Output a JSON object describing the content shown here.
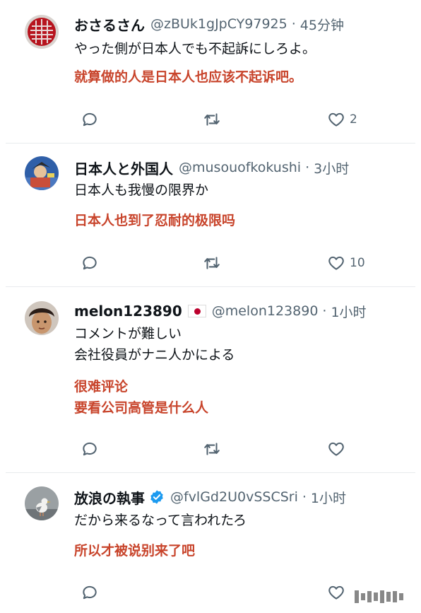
{
  "tweets": [
    {
      "name": "おさるさん",
      "handle": "@zBUk1gJpCY97925",
      "time": "45分钟",
      "lines": [
        "やった側が日本人でも不起訴にしろよ。"
      ],
      "translation": [
        "就算做的人是日本人也应该不起诉吧。"
      ],
      "likes": "2"
    },
    {
      "name": "日本人と外国人",
      "handle": "@musouofkokushi",
      "time": "3小时",
      "lines": [
        "日本人も我慢の限界か"
      ],
      "translation": [
        "日本人也到了忍耐的极限吗"
      ],
      "likes": "10"
    },
    {
      "name": "melon123890",
      "handle": "@melon123890",
      "time": "1小时",
      "lines": [
        "コメントが難しい",
        "会社役員がナニ人かによる"
      ],
      "translation": [
        "很难评论",
        "要看公司高管是什么人"
      ],
      "likes": ""
    },
    {
      "name": "放浪の執事",
      "handle": "@fvlGd2U0vSSCSri",
      "time": "1小时",
      "lines": [
        "だから来るなって言われたろ"
      ],
      "translation": [
        "所以才被说别来了吧"
      ],
      "likes": ""
    }
  ],
  "separator": "·",
  "icons": {
    "reply": "reply-icon",
    "retweet": "retweet-icon",
    "like": "heart-icon",
    "verified": "verified-badge-icon",
    "flag": "japan-flag-icon"
  },
  "colors": {
    "translation": "#c8442b",
    "secondary": "#536471",
    "verified": "#1d9bf0"
  }
}
